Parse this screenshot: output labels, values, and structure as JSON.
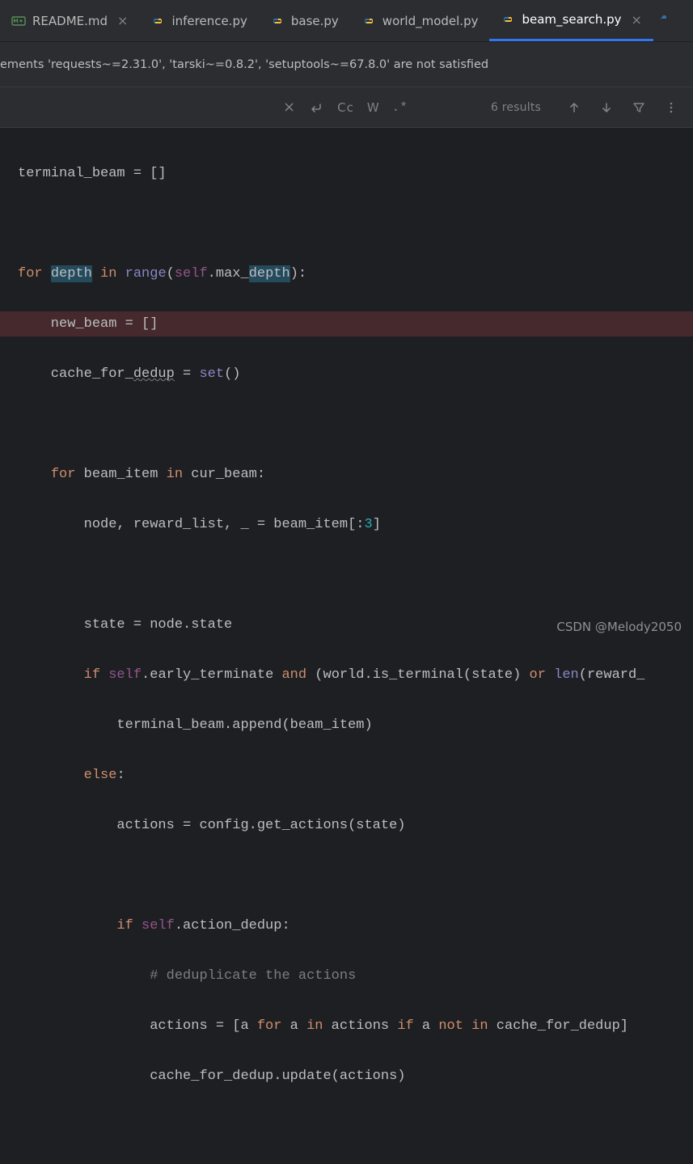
{
  "tabs": [
    {
      "name": "README.md",
      "icon": "markdown",
      "closable": true,
      "active": false
    },
    {
      "name": "inference.py",
      "icon": "python",
      "closable": false,
      "active": false
    },
    {
      "name": "base.py",
      "icon": "python",
      "closable": false,
      "active": false
    },
    {
      "name": "world_model.py",
      "icon": "python",
      "closable": false,
      "active": false
    },
    {
      "name": "beam_search.py",
      "icon": "python",
      "closable": true,
      "active": true
    }
  ],
  "banner": {
    "text": "ements 'requests~=2.31.0', 'tarski~=0.8.2', 'setuptools~=67.8.0' are not satisfied"
  },
  "find": {
    "results": "6 results",
    "cc_label": "Cc",
    "w_label": "W",
    "regex_label": ".*"
  },
  "code": {
    "l1_a": "terminal_beam = []",
    "l3_for": "for",
    "l3_sp1": " ",
    "l3_depth": "depth",
    "l3_in": " in ",
    "l3_range": "range",
    "l3_p1": "(",
    "l3_self": "self",
    "l3_dot": ".max_",
    "l3_depth2": "depth",
    "l3_p2": "):",
    "l4": "    new_beam = []",
    "l5_a": "    cache_for_",
    "l5_dedup": "dedup",
    "l5_b": " = ",
    "l5_set": "set",
    "l5_c": "()",
    "l7_for": "for",
    "l7_a": " beam_item ",
    "l7_in": "in",
    "l7_b": " cur_beam:",
    "l8_a": "        node, reward_list, _ = beam_item[:",
    "l8_num": "3",
    "l8_b": "]",
    "l10": "        state = node.state",
    "l11_if": "if",
    "l11_sp": " ",
    "l11_self": "self",
    "l11_a": ".early_terminate ",
    "l11_and": "and",
    "l11_b": " (world.is_terminal(state) ",
    "l11_or": "or",
    "l11_c": " ",
    "l11_len": "len",
    "l11_d": "(reward_",
    "l12": "terminal_beam.append(beam_item)",
    "l13_else": "else",
    "l13_a": ":",
    "l14": "actions = config.get_actions(state)",
    "l16_if": "if",
    "l16_sp": " ",
    "l16_self": "self",
    "l16_a": ".action_dedup:",
    "l17": "# deduplicate the actions",
    "l18_a": "actions = [a ",
    "l18_for": "for",
    "l18_b": " a ",
    "l18_in": "in",
    "l18_c": " actions ",
    "l18_if": "if",
    "l18_d": " a ",
    "l18_not": "not",
    "l18_e": " ",
    "l18_in2": "in",
    "l18_f": " cache_for_dedup]",
    "l19": "cache_for_dedup.update(actions)"
  },
  "watermark": "CSDN @Melody2050"
}
